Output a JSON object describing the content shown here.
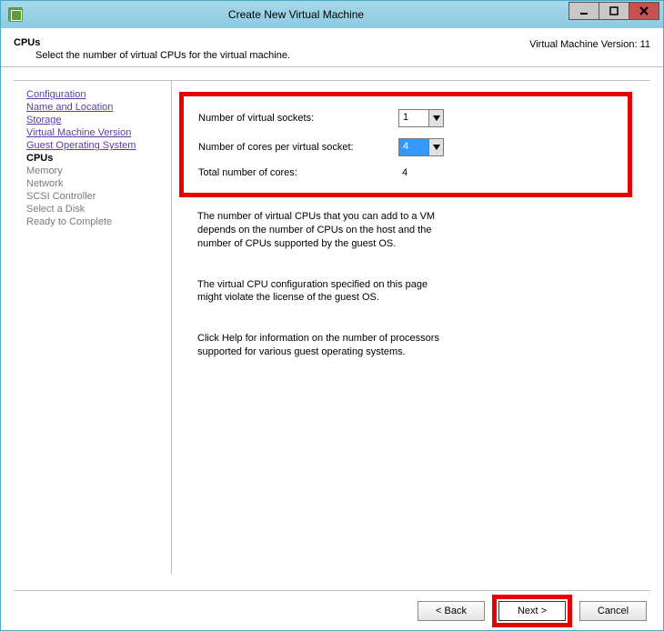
{
  "window": {
    "title": "Create New Virtual Machine"
  },
  "header": {
    "title": "CPUs",
    "subtitle": "Select the number of virtual CPUs for the virtual machine.",
    "version_label": "Virtual Machine Version: 11"
  },
  "sidebar": {
    "items": [
      {
        "label": "Configuration",
        "state": "link"
      },
      {
        "label": "Name and Location",
        "state": "link"
      },
      {
        "label": "Storage",
        "state": "link"
      },
      {
        "label": "Virtual Machine Version",
        "state": "link"
      },
      {
        "label": "Guest Operating System",
        "state": "link"
      },
      {
        "label": "CPUs",
        "state": "current"
      },
      {
        "label": "Memory",
        "state": "pending"
      },
      {
        "label": "Network",
        "state": "pending"
      },
      {
        "label": "SCSI Controller",
        "state": "pending"
      },
      {
        "label": "Select a Disk",
        "state": "pending"
      },
      {
        "label": "Ready to Complete",
        "state": "pending"
      }
    ]
  },
  "fields": {
    "sockets_label": "Number of virtual sockets:",
    "sockets_value": "1",
    "cores_label": "Number of cores per virtual socket:",
    "cores_value": "4",
    "total_label": "Total number of cores:",
    "total_value": "4"
  },
  "info": {
    "p1": "The number of virtual CPUs that you can add to a VM depends on the number of CPUs on the host and the number of CPUs supported by the guest OS.",
    "p2": "The virtual CPU configuration specified on this page might violate the license of the guest OS.",
    "p3": "Click Help for information on the number of processors supported for various guest operating systems."
  },
  "footer": {
    "back": "< Back",
    "next": "Next >",
    "cancel": "Cancel"
  }
}
